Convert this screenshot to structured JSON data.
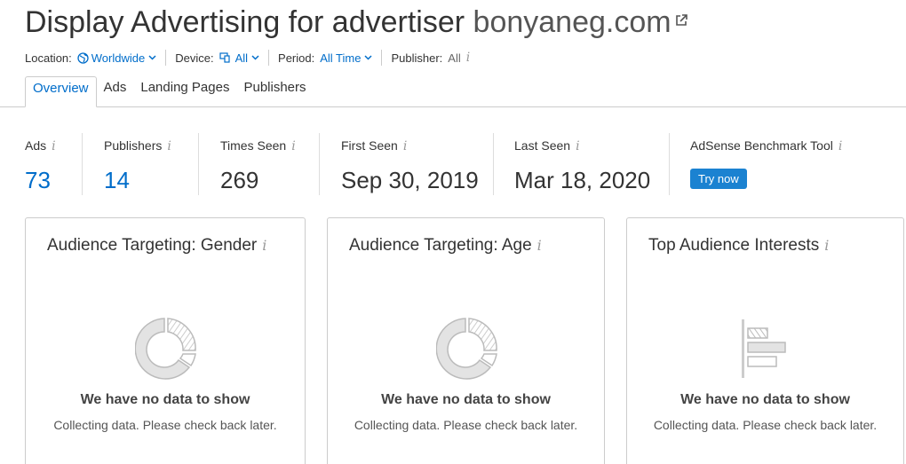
{
  "header": {
    "title": "Display Advertising for advertiser",
    "domain": "bonyaneg.com"
  },
  "filters": {
    "location_label": "Location:",
    "location_value": "Worldwide",
    "device_label": "Device:",
    "device_value": "All",
    "period_label": "Period:",
    "period_value": "All Time",
    "publisher_label": "Publisher:",
    "publisher_value": "All"
  },
  "tabs": [
    "Overview",
    "Ads",
    "Landing Pages",
    "Publishers"
  ],
  "metrics": {
    "ads_label": "Ads",
    "ads_value": "73",
    "publishers_label": "Publishers",
    "publishers_value": "14",
    "times_seen_label": "Times Seen",
    "times_seen_value": "269",
    "first_seen_label": "First Seen",
    "first_seen_value": "Sep 30, 2019",
    "last_seen_label": "Last Seen",
    "last_seen_value": "Mar 18, 2020",
    "adsense_label": "AdSense Benchmark Tool",
    "adsense_button": "Try now"
  },
  "cards": [
    {
      "title": "Audience Targeting: Gender",
      "icon": "donut-chart-icon",
      "nodata": "We have no data to show",
      "message": "Collecting data. Please check back later."
    },
    {
      "title": "Audience Targeting: Age",
      "icon": "donut-chart-icon",
      "nodata": "We have no data to show",
      "message": "Collecting data. Please check back later."
    },
    {
      "title": "Top Audience Interests",
      "icon": "bar-chart-icon",
      "nodata": "We have no data to show",
      "message": "Collecting data. Please check back later."
    }
  ],
  "colors": {
    "accent": "#006dca",
    "button": "#1b82d1",
    "border": "#cccccc"
  }
}
